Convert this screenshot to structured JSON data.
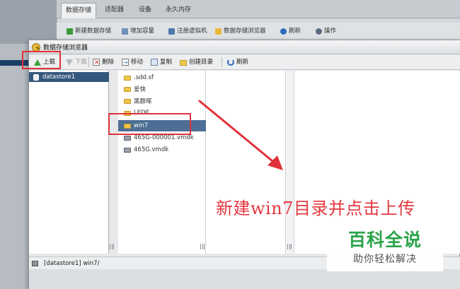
{
  "background": {
    "tabs": [
      "数据存储",
      "适配器",
      "设备",
      "永久内存"
    ],
    "toolbar": [
      "新建数据存储",
      "增加容量",
      "注册虚拟机",
      "数据存储浏览器",
      "刷新",
      "操作"
    ]
  },
  "dialog": {
    "title": "数据存储浏览器",
    "toolbar": {
      "upload": "上载",
      "download": "下载",
      "delete": "删除",
      "move": "移动",
      "copy": "复制",
      "create_dir": "创建目录",
      "refresh": "刷新"
    },
    "tree": {
      "datastore": "datastore1"
    },
    "files": [
      {
        "name": ".sdd.sf",
        "type": "folder"
      },
      {
        "name": "爱快",
        "type": "folder"
      },
      {
        "name": "黑群晖",
        "type": "folder"
      },
      {
        "name": "LEDE",
        "type": "folder"
      },
      {
        "name": "win7",
        "type": "folder",
        "selected": true
      },
      {
        "name": "465G-000001.vmdk",
        "type": "disk"
      },
      {
        "name": "465G.vmdk",
        "type": "disk"
      }
    ],
    "status_path": "[datastore1] win7/"
  },
  "annotation": {
    "text": "新建win7目录并点击上传",
    "color": "#e2383f"
  },
  "watermark": {
    "title": "百科全说",
    "subtitle": "助你轻松解决"
  }
}
